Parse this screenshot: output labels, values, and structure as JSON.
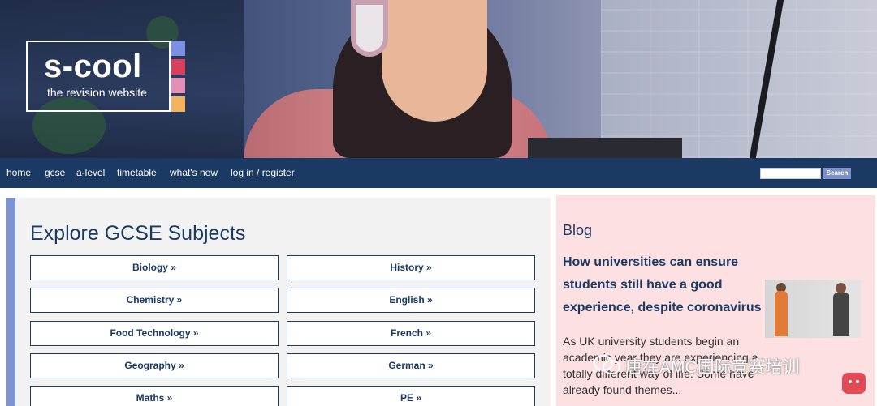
{
  "logo": {
    "title": "s-cool",
    "tagline": "the revision website",
    "bar_colors": [
      "#7d8fe0",
      "#d8405e",
      "#e38fb6",
      "#f2b45c"
    ]
  },
  "nav": {
    "items": [
      "home",
      "gcse",
      "a-level",
      "timetable",
      "what's new",
      "log in / register"
    ],
    "search_button": "Search",
    "search_value": ""
  },
  "subjects": {
    "title": "Explore GCSE Subjects",
    "left": [
      "Biology »",
      "Chemistry »",
      "Food Technology »",
      "Geography »",
      "Maths »"
    ],
    "right": [
      "History »",
      "English »",
      "French »",
      "German »",
      "PE »"
    ]
  },
  "blog": {
    "label": "Blog",
    "headline": "How universities can ensure students still have a good experience, despite coronavirus",
    "excerpt": "As UK university students begin an academic year they are experiencing a totally different way of life. Some have already found themes..."
  },
  "watermark": {
    "text": "唐在AMC国际竞赛培训"
  },
  "colors": {
    "navy": "#1b3a63",
    "accent_blue": "#7c94d6",
    "blog_bg": "#fde0e1",
    "panel_bg": "#f2f2f3"
  }
}
